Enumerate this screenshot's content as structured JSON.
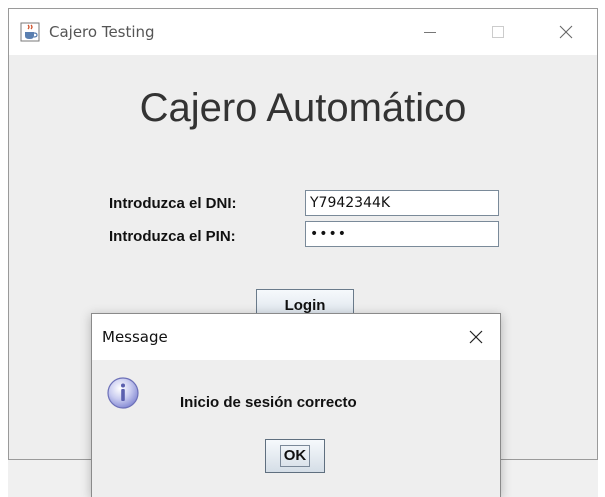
{
  "main_window": {
    "title": "Cajero Testing",
    "heading": "Cajero Automático",
    "dni_label": "Introduzca el DNI:",
    "dni_value": "Y7942344K",
    "pin_label": "Introduzca el PIN:",
    "pin_value": "••••",
    "login_label": "Login"
  },
  "dialog": {
    "title": "Message",
    "message": "Inicio de sesión correcto",
    "ok_label": "OK"
  },
  "colors": {
    "window_bg": "#eeeeee",
    "titlebar_bg": "#ffffff",
    "info_icon": "#8a8fd6"
  },
  "icons": {
    "app": "java-cup-icon",
    "minimize": "minimize-icon",
    "maximize": "maximize-icon",
    "close": "close-icon",
    "info": "info-icon"
  }
}
